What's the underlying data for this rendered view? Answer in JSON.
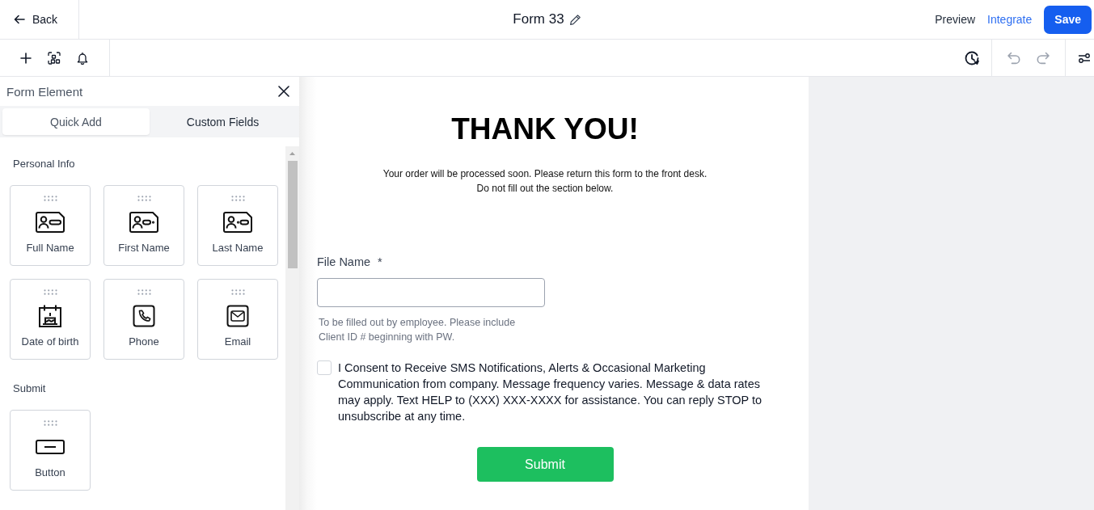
{
  "header": {
    "back_label": "Back",
    "title": "Form 33",
    "actions": [
      {
        "kind": "plain",
        "label": "Preview"
      },
      {
        "kind": "link",
        "label": "Integrate"
      },
      {
        "kind": "primary",
        "label": "Save"
      }
    ]
  },
  "toolbar": {
    "edit_actions": [
      {
        "kind": "undo",
        "disabled": true
      },
      {
        "kind": "redo",
        "disabled": true
      }
    ]
  },
  "panel": {
    "title": "Form Element",
    "tabs": [
      {
        "label": "Quick Add",
        "selected": true
      },
      {
        "label": "Custom Fields",
        "selected": false
      }
    ],
    "sections": [
      {
        "title": "Personal Info",
        "items": [
          {
            "kind": "full_name",
            "label": "Full Name"
          },
          {
            "kind": "first_name",
            "label": "First Name"
          },
          {
            "kind": "last_name",
            "label": "Last Name"
          },
          {
            "kind": "date",
            "label": "Date of birth"
          },
          {
            "kind": "phone",
            "label": "Phone"
          },
          {
            "kind": "email",
            "label": "Email"
          }
        ]
      },
      {
        "title": "Submit",
        "items": [
          {
            "kind": "button",
            "label": "Button"
          }
        ]
      }
    ]
  },
  "form": {
    "heading": "THANK YOU!",
    "intro_lines": [
      "Your order will be processed soon. Please return this form to the front desk.",
      "Do not fill out the section below."
    ],
    "fields": [
      {
        "label": "File Name",
        "required_mark": "*",
        "help_lines": [
          "To be filled out by employee. Please include",
          "Client ID # beginning with PW."
        ]
      }
    ],
    "consent": {
      "checked": false,
      "text": "I Consent to Receive SMS Notifications, Alerts & Occasional Marketing Communication from company. Message frequency varies. Message & data rates may apply. Text HELP to (XXX) XXX-XXXX for assistance. You can reply STOP to unsubscribe at any time."
    },
    "submit_label": "Submit"
  }
}
